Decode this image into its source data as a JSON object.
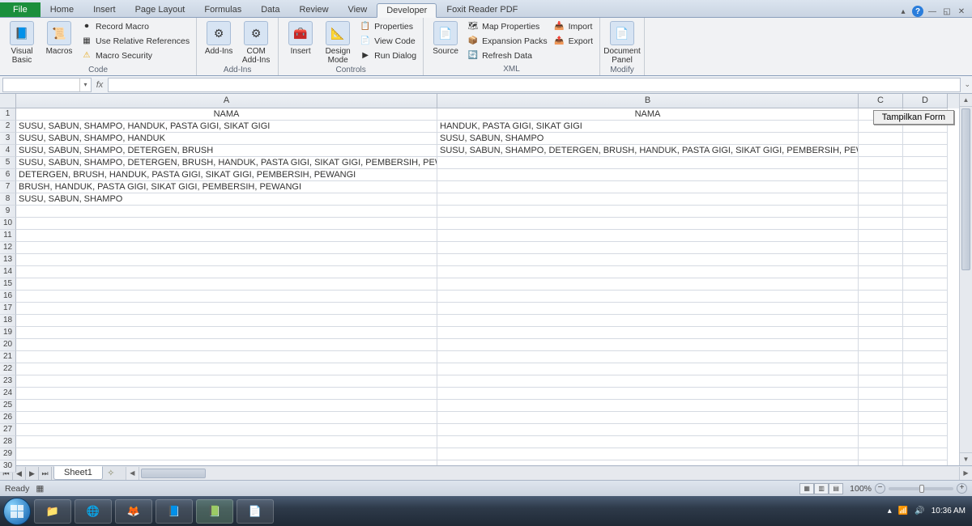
{
  "tabs": {
    "file": "File",
    "home": "Home",
    "insert": "Insert",
    "pageLayout": "Page Layout",
    "formulas": "Formulas",
    "data": "Data",
    "review": "Review",
    "view": "View",
    "developer": "Developer",
    "foxit": "Foxit Reader PDF"
  },
  "ribbon": {
    "code": {
      "vb": "Visual\nBasic",
      "macros": "Macros",
      "record": "Record Macro",
      "relrefs": "Use Relative References",
      "security": "Macro Security",
      "label": "Code"
    },
    "addins": {
      "addins": "Add-Ins",
      "com": "COM\nAdd-Ins",
      "label": "Add-Ins"
    },
    "controls": {
      "insert": "Insert",
      "design": "Design\nMode",
      "props": "Properties",
      "viewcode": "View Code",
      "rundlg": "Run Dialog",
      "label": "Controls"
    },
    "xml": {
      "source": "Source",
      "mapprops": "Map Properties",
      "expansion": "Expansion Packs",
      "refresh": "Refresh Data",
      "import": "Import",
      "export": "Export",
      "label": "XML"
    },
    "modify": {
      "docpanel": "Document\nPanel",
      "label": "Modify"
    }
  },
  "fx": {
    "fxLabel": "fx"
  },
  "columns": {
    "A": "A",
    "B": "B",
    "C": "C",
    "D": "D"
  },
  "headers": {
    "nama": "NAMA"
  },
  "colA": [
    "SUSU, SABUN, SHAMPO, HANDUK, PASTA GIGI, SIKAT GIGI",
    "SUSU, SABUN, SHAMPO, HANDUK",
    "SUSU, SABUN, SHAMPO, DETERGEN, BRUSH",
    "SUSU, SABUN, SHAMPO, DETERGEN, BRUSH, HANDUK, PASTA GIGI, SIKAT GIGI, PEMBERSIH, PEWANGI",
    "DETERGEN, BRUSH, HANDUK, PASTA GIGI, SIKAT GIGI, PEMBERSIH, PEWANGI",
    "BRUSH, HANDUK, PASTA GIGI, SIKAT GIGI, PEMBERSIH, PEWANGI",
    "SUSU, SABUN, SHAMPO"
  ],
  "colB": [
    "HANDUK, PASTA GIGI, SIKAT GIGI",
    "SUSU, SABUN, SHAMPO",
    "SUSU, SABUN, SHAMPO, DETERGEN, BRUSH, HANDUK, PASTA GIGI, SIKAT GIGI, PEMBERSIH, PEWANGI"
  ],
  "formBtn": "Tampilkan Form",
  "sheet": {
    "tab1": "Sheet1"
  },
  "status": {
    "ready": "Ready",
    "zoom": "100%"
  },
  "taskbar": {
    "time": "10:36 AM"
  }
}
